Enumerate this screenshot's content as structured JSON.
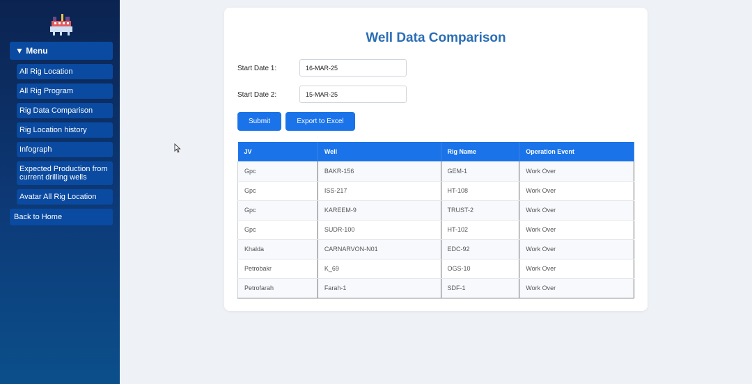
{
  "sidebar": {
    "menu_label": "▼ Menu",
    "items": [
      {
        "label": "All Rig Location"
      },
      {
        "label": "All Rig Program"
      },
      {
        "label": "Rig Data Comparison"
      },
      {
        "label": "Rig Location history"
      },
      {
        "label": "Infograph"
      },
      {
        "label": "Expected Production from current drilling wells"
      },
      {
        "label": "Avatar All Rig Location"
      }
    ],
    "back_label": "Back to Home"
  },
  "form": {
    "title": "Well Data Comparison",
    "start_date_1_label": "Start Date 1:",
    "start_date_1_value": "16-MAR-25",
    "start_date_2_label": "Start Date 2:",
    "start_date_2_value": "15-MAR-25",
    "submit_label": "Submit",
    "export_label": "Export to Excel"
  },
  "table": {
    "headers": [
      "JV",
      "Well",
      "Rig Name",
      "Operation Event"
    ],
    "rows": [
      [
        "Gpc",
        "BAKR-156",
        "GEM-1",
        "Work Over"
      ],
      [
        "Gpc",
        "ISS-217",
        "HT-108",
        "Work Over"
      ],
      [
        "Gpc",
        "KAREEM-9",
        "TRUST-2",
        "Work Over"
      ],
      [
        "Gpc",
        "SUDR-100",
        "HT-102",
        "Work Over"
      ],
      [
        "Khalda",
        "CARNARVON-N01",
        "EDC-92",
        "Work Over"
      ],
      [
        "Petrobakr",
        "K_69",
        "OGS-10",
        "Work Over"
      ],
      [
        "Petrofarah",
        "Farah-1",
        "SDF-1",
        "Work Over"
      ]
    ]
  },
  "colors": {
    "accent": "#1a73e8",
    "sidebar_top": "#0b2350",
    "sidebar_bottom": "#0b4f8a",
    "title": "#2a6eb5"
  }
}
